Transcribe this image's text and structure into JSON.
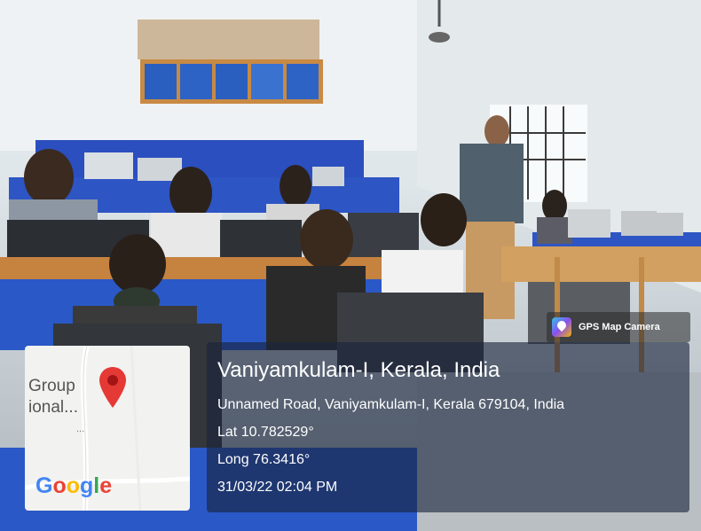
{
  "stamp": {
    "app_name": "GPS Map Camera",
    "location_title": "Vaniyamkulam-I, Kerala, India",
    "address": "Unnamed Road, Vaniyamkulam-I, Kerala 679104, India",
    "latitude": "Lat 10.782529°",
    "longitude": "Long 76.3416°",
    "datetime": "31/03/22 02:04 PM"
  },
  "map": {
    "place_line1": "Group",
    "place_line2": "ional...",
    "ellipsis": "...",
    "brand": "Google",
    "pin_color": "#e53935"
  }
}
